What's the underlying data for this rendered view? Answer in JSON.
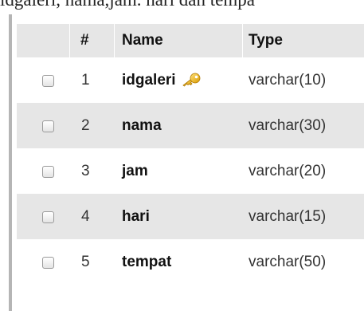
{
  "caption": "idgaleri, nama,jam. hari dan tempa",
  "table": {
    "headers": {
      "number": "#",
      "name": "Name",
      "type": "Type"
    },
    "rows": [
      {
        "number": "1",
        "name": "idgaleri",
        "type": "varchar(10)",
        "primary_key_icon": "key-icon"
      },
      {
        "number": "2",
        "name": "nama",
        "type": "varchar(30)"
      },
      {
        "number": "3",
        "name": "jam",
        "type": "varchar(20)"
      },
      {
        "number": "4",
        "name": "hari",
        "type": "varchar(15)"
      },
      {
        "number": "5",
        "name": "tempat",
        "type": "varchar(50)"
      }
    ]
  },
  "colors": {
    "row_shade": "#e6e6e6",
    "key_gold": "#e8b200"
  }
}
